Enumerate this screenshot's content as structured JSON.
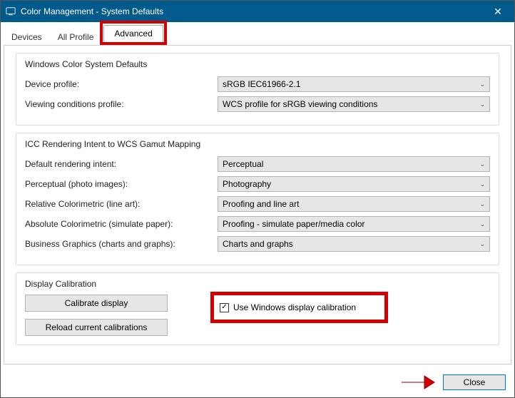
{
  "titlebar": {
    "title": "Color Management - System Defaults"
  },
  "tabs": {
    "devices": "Devices",
    "allProfiles": "All Profile",
    "advanced": "Advanced"
  },
  "wcs": {
    "groupTitle": "Windows Color System Defaults",
    "deviceProfileLabel": "Device profile:",
    "deviceProfileValue": "sRGB IEC61966-2.1",
    "viewingConditionsLabel": "Viewing conditions profile:",
    "viewingConditionsValue": "WCS profile for sRGB viewing conditions"
  },
  "icc": {
    "groupTitle": "ICC Rendering Intent to WCS Gamut Mapping",
    "defaultLabel": "Default rendering intent:",
    "defaultValue": "Perceptual",
    "perceptualLabel": "Perceptual (photo images):",
    "perceptualValue": "Photography",
    "relativeLabel": "Relative Colorimetric (line art):",
    "relativeValue": "Proofing and line art",
    "absoluteLabel": "Absolute Colorimetric (simulate paper):",
    "absoluteValue": "Proofing - simulate paper/media color",
    "businessLabel": "Business Graphics (charts and graphs):",
    "businessValue": "Charts and graphs"
  },
  "calib": {
    "groupTitle": "Display Calibration",
    "calibrateBtn": "Calibrate display",
    "reloadBtn": "Reload current calibrations",
    "useWindowsLabel": "Use Windows display calibration"
  },
  "footer": {
    "close": "Close"
  },
  "highlights": {
    "color": "#d30000"
  }
}
